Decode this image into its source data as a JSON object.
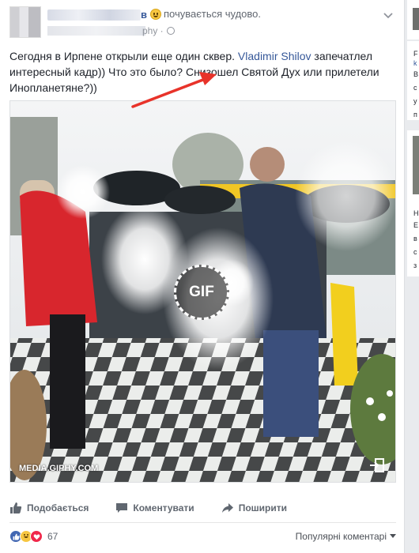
{
  "post": {
    "author_suffix": "в",
    "feeling": "почувається чудово.",
    "meta_suffix": "phy ·",
    "text_before": "Сегодня в Ирпене открыли еще один сквер. ",
    "mention": "Vladimir Shilov",
    "text_after": " запечатлел интересный кадр)) Что это было? Снизошел Святой Дух или прилетели Инопланетяне?))"
  },
  "media": {
    "badge": "GIF",
    "source": "MEDIA.GIPHY.COM",
    "expand_icon": "expand-icon"
  },
  "actions": {
    "like": "Подобається",
    "comment": "Коментувати",
    "share": "Поширити"
  },
  "footer": {
    "reaction_count": "67",
    "sort_label": "Популярні коментарі"
  },
  "sidebar": {
    "chars": [
      "F",
      "k",
      "В",
      "с",
      "у",
      "п",
      "Н",
      "Е",
      "в",
      "с",
      "з"
    ]
  },
  "colors": {
    "link": "#365899",
    "muted": "#90949c",
    "arrow": "#e8332a",
    "action_text": "#606770"
  }
}
